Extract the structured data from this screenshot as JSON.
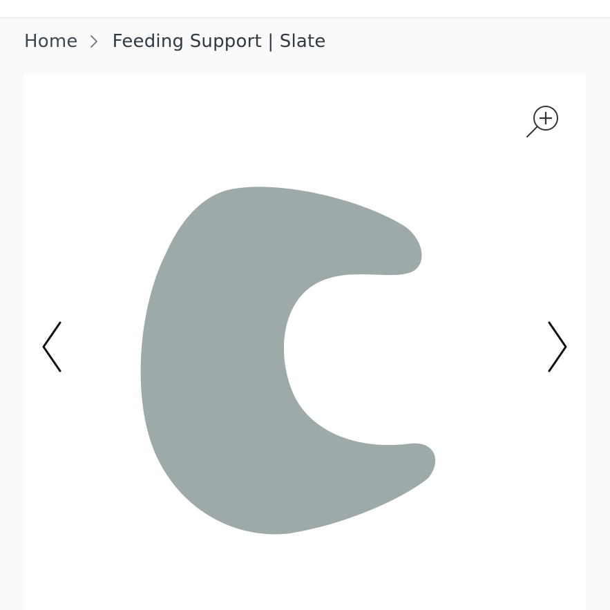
{
  "breadcrumb": {
    "home_label": "Home",
    "current_label": "Feeding Support | Slate",
    "separator_icon": "chevron-right-icon"
  },
  "gallery": {
    "zoom_icon": "zoom-in-icon",
    "prev_icon": "chevron-left-icon",
    "next_icon": "chevron-right-icon",
    "product_color": "#9eaaaa"
  }
}
